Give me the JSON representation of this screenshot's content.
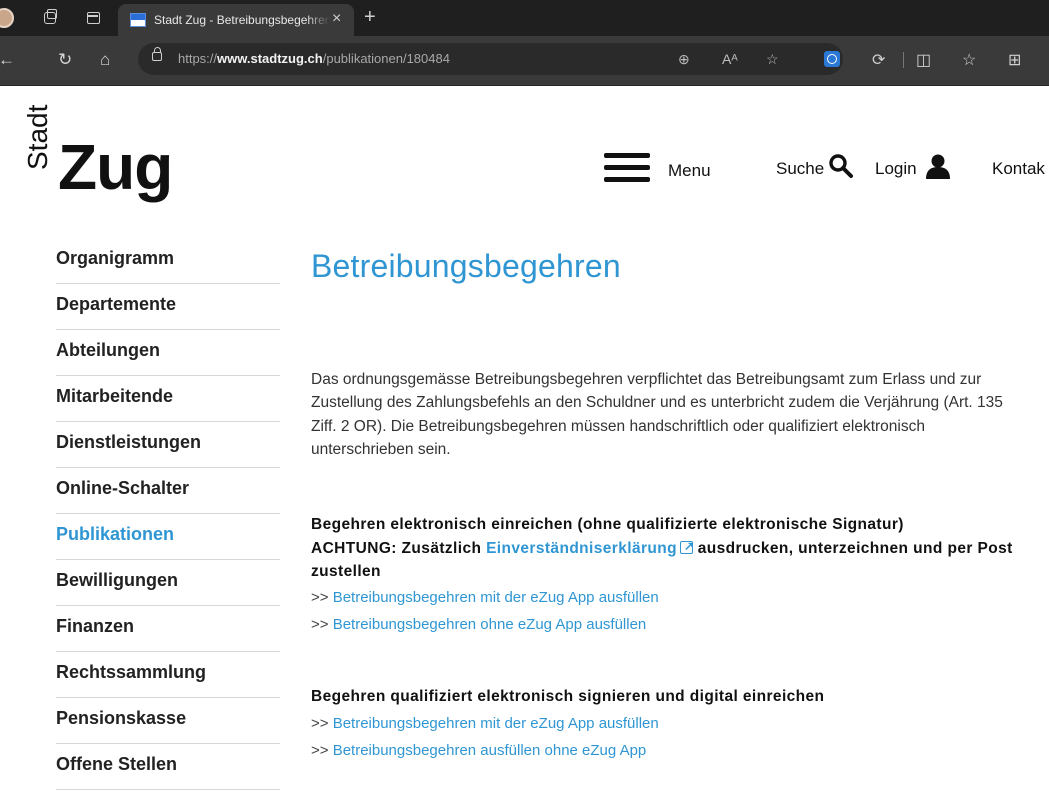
{
  "browser": {
    "tab_title": "Stadt Zug - Betreibungsbegehren",
    "tab_close": "×",
    "new_tab": "+",
    "url_prefix": "https://",
    "url_domain": "www.stadtzug.ch",
    "url_path": "/publikationen/180484"
  },
  "header": {
    "logo_top": "Stadt",
    "logo_main": "Zug",
    "menu_label": "Menu",
    "search_label": "Suche",
    "login_label": "Login",
    "contact_label": "Kontak"
  },
  "sidebar": {
    "items": [
      {
        "label": "Organigramm"
      },
      {
        "label": "Departemente"
      },
      {
        "label": "Abteilungen"
      },
      {
        "label": "Mitarbeitende"
      },
      {
        "label": "Dienstleistungen"
      },
      {
        "label": "Online-Schalter"
      },
      {
        "label": "Publikationen"
      },
      {
        "label": "Bewilligungen"
      },
      {
        "label": "Finanzen"
      },
      {
        "label": "Rechtssammlung"
      },
      {
        "label": "Pensionskasse"
      },
      {
        "label": "Offene Stellen"
      }
    ]
  },
  "main": {
    "title": "Betreibungsbegehren",
    "intro": "Das ordnungsgemässe Betreibungsbegehren verpflichtet das Betreibungsamt zum Erlass und zur Zustellung des Zahlungsbefehls an den Schuldner und es unterbricht zudem die Verjährung (Art. 135 Ziff. 2 OR). Die Betreibungsbegehren müssen handschriftlich oder qualifiziert elektronisch unterschrieben sein.",
    "section1": {
      "heading": "Begehren elektronisch einreichen (ohne qualifizierte elektronische Signatur)",
      "achtung_pre": "ACHTUNG: Zusätzlich ",
      "achtung_link": "Einverständniserklärung",
      "achtung_post": " ausdrucken, unterzeichnen und per Post zustellen",
      "link_prefix": ">> ",
      "links": [
        "Betreibungsbegehren mit der eZug App ausfüllen",
        "Betreibungsbegehren ohne eZug App ausfüllen"
      ]
    },
    "section2": {
      "heading": "Begehren qualifiziert elektronisch signieren und digital einreichen",
      "link_prefix": ">> ",
      "links": [
        "Betreibungsbegehren mit der eZug App ausfüllen",
        "Betreibungsbegehren ausfüllen ohne eZug App"
      ]
    }
  },
  "colors": {
    "accent": "#2f96d3",
    "text": "#222222",
    "chrome_dark": "#1f1f1f"
  }
}
